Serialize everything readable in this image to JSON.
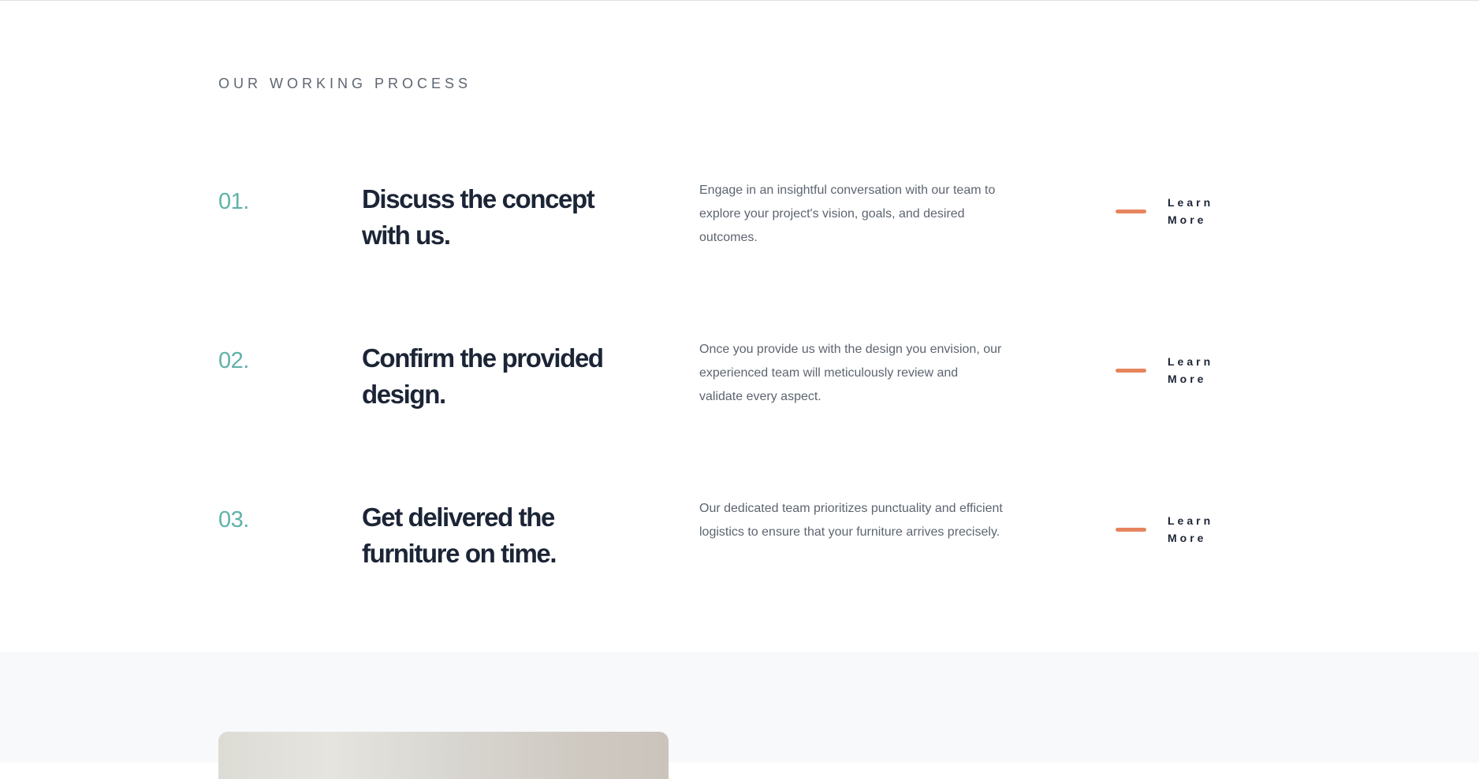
{
  "section": {
    "label": "OUR WORKING PROCESS"
  },
  "steps": [
    {
      "number": "01.",
      "title": "Discuss the concept with us.",
      "description": "Engage in an insightful conversation with our team to explore your project's vision, goals, and desired outcomes.",
      "cta_label": "Learn More"
    },
    {
      "number": "02.",
      "title": "Confirm the provided design.",
      "description": "Once you provide us with the design you envision, our experienced team will meticulously review and validate every aspect.",
      "cta_label": "Learn More"
    },
    {
      "number": "03.",
      "title": "Get delivered the furniture on time.",
      "description": "Our dedicated team prioritizes punctuality and efficient logistics to ensure that your furniture arrives precisely.",
      "cta_label": "Learn More"
    }
  ],
  "colors": {
    "accent_number": "#5fb2a9",
    "accent_dash": "#e6845e",
    "heading": "#1c2536",
    "body_text": "#5d6570"
  }
}
